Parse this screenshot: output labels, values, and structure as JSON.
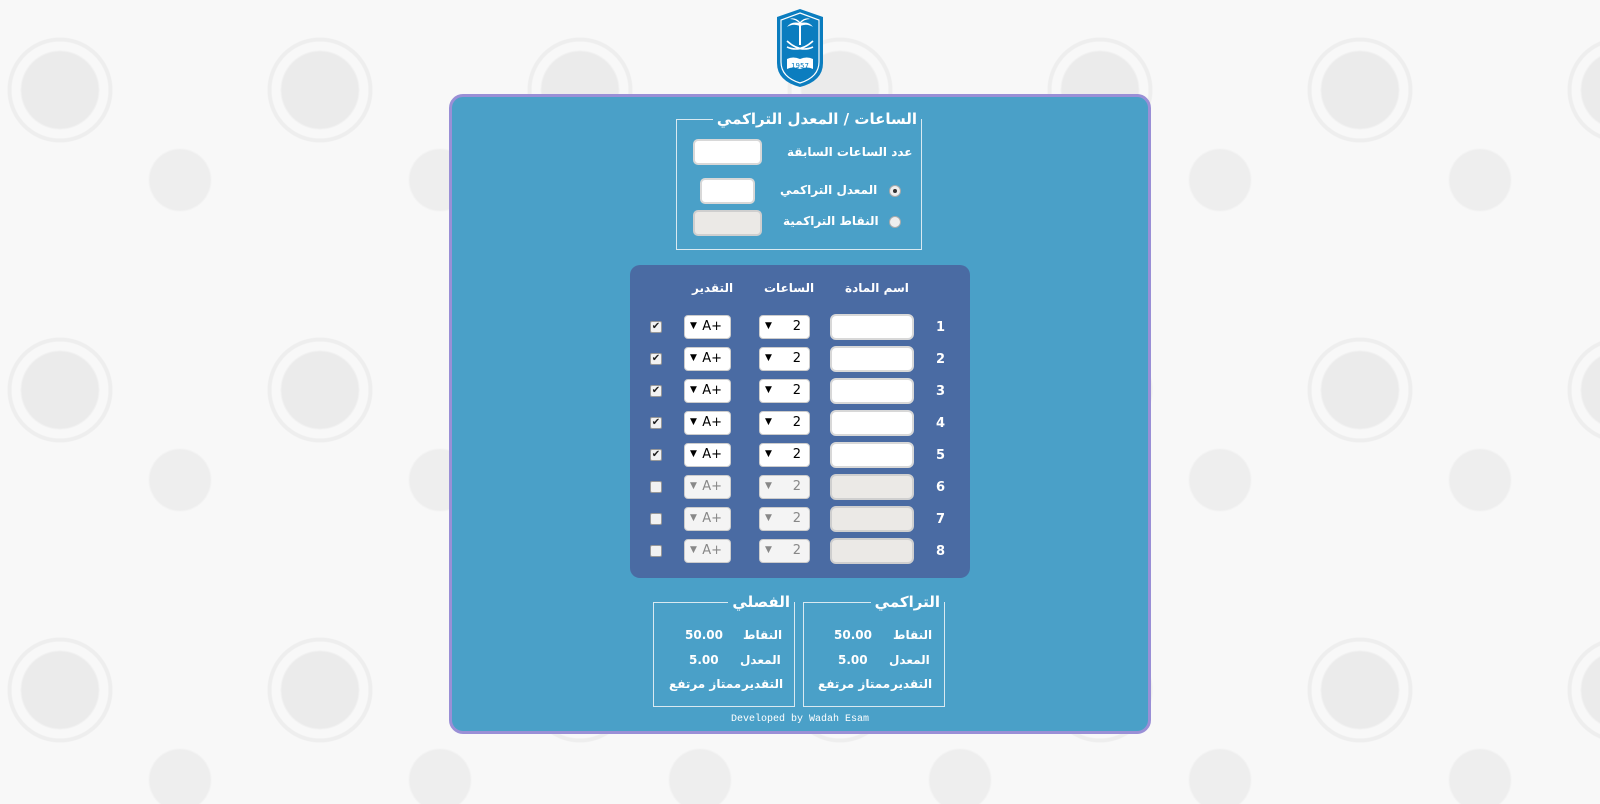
{
  "logo": {
    "year": "1957"
  },
  "hours_panel": {
    "legend": "الساعات / المعدل التراكمي",
    "prev_hours_label": "عدد الساعات السابقة",
    "prev_hours_value": "",
    "gpa_label": "المعدل التراكمي",
    "gpa_value": "",
    "points_label": "النقاط التراكمية",
    "points_value": "",
    "selected_option": "gpa"
  },
  "courses": {
    "headers": {
      "name": "اسم المادة",
      "hours": "الساعات",
      "grade": "التقدير"
    },
    "rows": [
      {
        "num": "1",
        "hours": "2",
        "grade": "A+",
        "checked": true
      },
      {
        "num": "2",
        "hours": "2",
        "grade": "A+",
        "checked": true
      },
      {
        "num": "3",
        "hours": "2",
        "grade": "A+",
        "checked": true
      },
      {
        "num": "4",
        "hours": "2",
        "grade": "A+",
        "checked": true
      },
      {
        "num": "5",
        "hours": "2",
        "grade": "A+",
        "checked": true
      },
      {
        "num": "6",
        "hours": "2",
        "grade": "A+",
        "checked": false
      },
      {
        "num": "7",
        "hours": "2",
        "grade": "A+",
        "checked": false
      },
      {
        "num": "8",
        "hours": "2",
        "grade": "A+",
        "checked": false
      }
    ]
  },
  "cumulative": {
    "legend": "التراكمي",
    "points_label": "النقاط",
    "points_value": "50.00",
    "gpa_label": "المعدل",
    "gpa_value": "5.00",
    "grade_label": "التقدير",
    "grade_value": "ممتاز مرتفع"
  },
  "semester": {
    "legend": "الفصلي",
    "points_label": "النقاط",
    "points_value": "50.00",
    "gpa_label": "المعدل",
    "gpa_value": "5.00",
    "grade_label": "التقدير",
    "grade_value": "ممتاز مرتفع"
  },
  "footer": {
    "credit": "Developed by Wadah Esam"
  },
  "colors": {
    "panel": "#4aa0c8",
    "table": "#4a6ba3",
    "panel_border": "#9a8fd6",
    "logo": "#0b7dbf"
  }
}
